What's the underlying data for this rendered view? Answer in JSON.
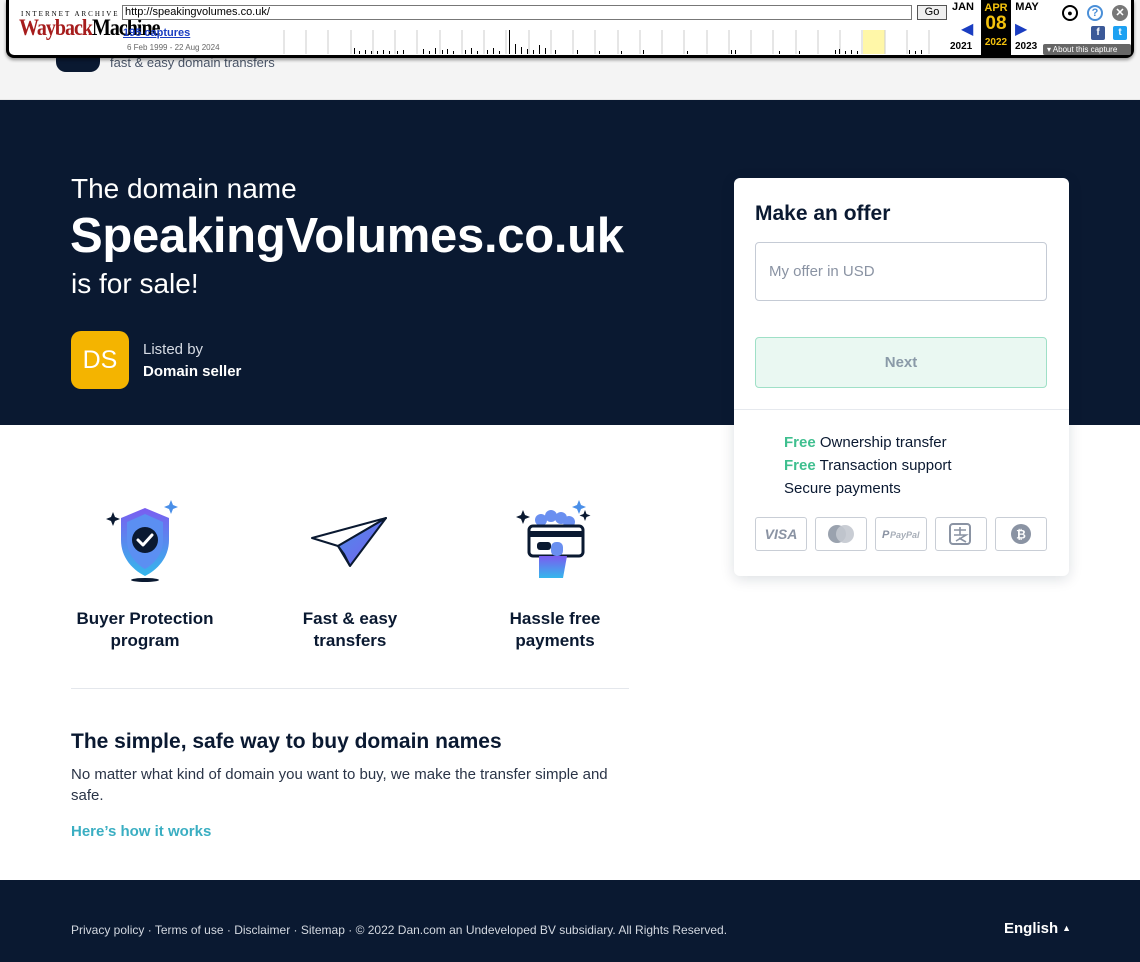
{
  "wayback": {
    "ia_label": "INTERNET ARCHIVE",
    "logo_red": "Wayback",
    "logo_black": "Machine",
    "url": "http://speakingvolumes.co.uk/",
    "go_label": "Go",
    "captures": "195 captures",
    "date_range": "6 Feb 1999 - 22 Aug 2024",
    "prev_month": "JAN",
    "current_month": "APR",
    "next_month": "MAY",
    "current_day": "08",
    "prev_year": "2021",
    "current_year": "2022",
    "next_year": "2023",
    "about": "About this capture"
  },
  "site": {
    "tagline": "fast & easy domain transfers"
  },
  "hero": {
    "pre": "The domain name",
    "domain": "SpeakingVolumes.co.uk",
    "post": "is for sale!",
    "seller_initials": "DS",
    "listed_by": "Listed by",
    "seller_name": "Domain seller"
  },
  "offer": {
    "title": "Make an offer",
    "input_placeholder": "My offer in USD",
    "next_label": "Next",
    "features": [
      {
        "free": "Free",
        "text": " Ownership transfer"
      },
      {
        "free": "Free",
        "text": " Transaction support"
      },
      {
        "free": "",
        "text": "Secure payments"
      }
    ],
    "payment_methods": [
      "visa-icon",
      "mastercard-icon",
      "paypal-icon",
      "alipay-icon",
      "bitcoin-icon"
    ]
  },
  "features": [
    {
      "label": "Buyer Protection program",
      "icon": "shield-check-icon"
    },
    {
      "label": "Fast & easy transfers",
      "icon": "paper-plane-icon"
    },
    {
      "label": "Hassle free payments",
      "icon": "card-hand-icon"
    }
  ],
  "simple": {
    "title": "The simple, safe way to buy domain names",
    "text": "No matter what kind of domain you want to buy, we make the transfer simple and safe.",
    "link": "Here’s how it works"
  },
  "footer": {
    "privacy": "Privacy policy",
    "terms": "Terms of use",
    "disclaimer": "Disclaimer",
    "sitemap": "Sitemap",
    "copyright": "© 2022 Dan.com an Undeveloped BV subsidiary. All Rights Reserved.",
    "language": "English"
  },
  "colors": {
    "navy": "#0a1931",
    "green": "#3fbf8f",
    "link": "#3aaec2",
    "seller_avatar": "#f4b400"
  }
}
